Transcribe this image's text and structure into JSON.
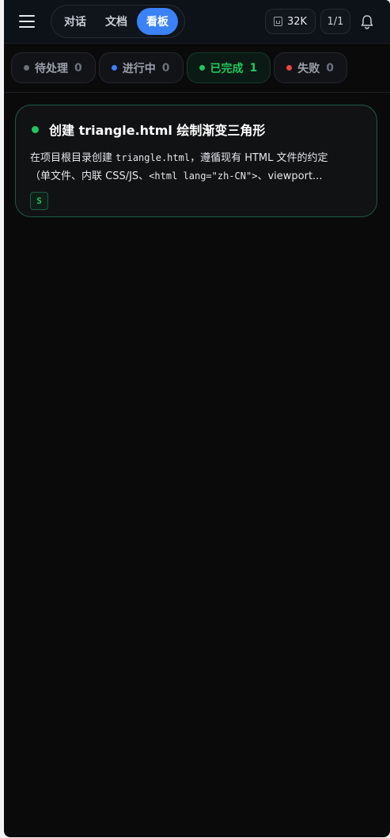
{
  "header": {
    "nav": [
      "对话",
      "文档",
      "看板"
    ],
    "active_nav": "看板",
    "tokens": "32K",
    "page": "1/1"
  },
  "status_tabs": [
    {
      "label": "待处理",
      "count": "0",
      "color": "#6b7079"
    },
    {
      "label": "进行中",
      "count": "0",
      "color": "#3b82f6"
    },
    {
      "label": "已完成",
      "count": "1",
      "color": "#22c55e"
    },
    {
      "label": "失败",
      "count": "0",
      "color": "#ef4444"
    }
  ],
  "task": {
    "title": "创建 triangle.html 绘制渐变三角形",
    "desc_line1_a": "在项目根目录创建 ",
    "desc_line1_code": "triangle.html",
    "desc_line1_b": "，遵循现有 HTML 文件的约定",
    "desc_line2_a": "（单文件、内联 CSS/JS、",
    "desc_line2_code": "<html lang=\"zh-CN\">",
    "desc_line2_b": "、viewport...",
    "badge": "S",
    "status_color": "#22c55e"
  },
  "icons": {
    "menu": "hamburger-menu-icon",
    "tokens": "token-icon",
    "bell": "bell-icon"
  }
}
